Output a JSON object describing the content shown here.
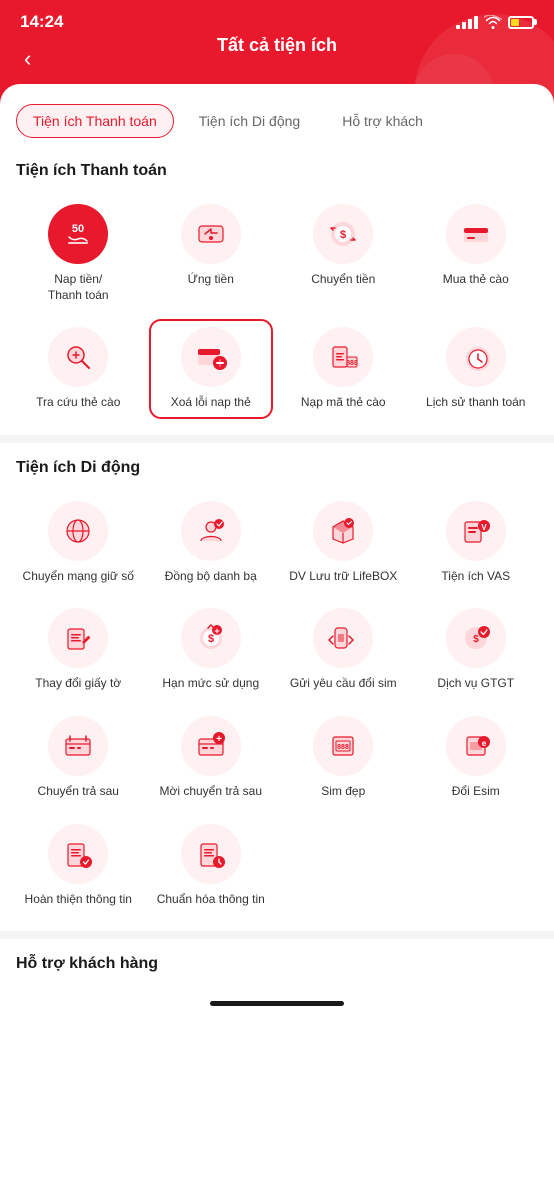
{
  "statusBar": {
    "time": "14:24"
  },
  "header": {
    "title": "Tất cả tiện ích",
    "backLabel": "<"
  },
  "tabs": [
    {
      "id": "payment",
      "label": "Tiện ích Thanh toán",
      "active": true
    },
    {
      "id": "mobile",
      "label": "Tiện ích Di động",
      "active": false
    },
    {
      "id": "support",
      "label": "Hỗ trợ khách",
      "active": false
    }
  ],
  "sections": {
    "payment": {
      "title": "Tiện ích Thanh toán",
      "items": [
        {
          "id": "nap-tien",
          "label": "Nap tiền/\nThanh toán",
          "highlighted": false
        },
        {
          "id": "ung-tien",
          "label": "Ứng tiền",
          "highlighted": false
        },
        {
          "id": "chuyen-tien",
          "label": "Chuyển tiền",
          "highlighted": false
        },
        {
          "id": "mua-the-cao",
          "label": "Mua thẻ cào",
          "highlighted": false
        },
        {
          "id": "tra-cuu-the-cao",
          "label": "Tra cứu thẻ cào",
          "highlighted": false
        },
        {
          "id": "xoa-loi-nap-the",
          "label": "Xoá lỗi nap thẻ",
          "highlighted": true
        },
        {
          "id": "nap-ma-the-cao",
          "label": "Nạp mã thẻ cào",
          "highlighted": false
        },
        {
          "id": "lich-su-thanh-toan",
          "label": "Lịch sử thanh toán",
          "highlighted": false
        }
      ]
    },
    "mobile": {
      "title": "Tiện ích Di động",
      "items": [
        {
          "id": "chuyen-mang-giu-so",
          "label": "Chuyển mạng giữ số",
          "highlighted": false
        },
        {
          "id": "dong-bo-danh-ba",
          "label": "Đồng bộ danh bạ",
          "highlighted": false
        },
        {
          "id": "dv-luu-tru-lifebox",
          "label": "DV Lưu trữ LifeBOX",
          "highlighted": false
        },
        {
          "id": "tien-ich-vas",
          "label": "Tiện ích VAS",
          "highlighted": false
        },
        {
          "id": "thay-doi-giay-to",
          "label": "Thay đổi giấy tờ",
          "highlighted": false
        },
        {
          "id": "han-muc-su-dung",
          "label": "Hạn mức sử dụng",
          "highlighted": false
        },
        {
          "id": "gui-yeu-cau-doi-sim",
          "label": "Gửi yêu cầu đổi sim",
          "highlighted": false
        },
        {
          "id": "dich-vu-gtgt",
          "label": "Dịch vụ GTGT",
          "highlighted": false
        },
        {
          "id": "chuyen-tra-sau",
          "label": "Chuyển trả sau",
          "highlighted": false
        },
        {
          "id": "moi-chuyen-tra-sau",
          "label": "Mời chuyển trả sau",
          "highlighted": false
        },
        {
          "id": "sim-dep",
          "label": "Sim đẹp",
          "highlighted": false
        },
        {
          "id": "doi-esim",
          "label": "Đổi Esim",
          "highlighted": false
        },
        {
          "id": "hoan-thien-thong-tin",
          "label": "Hoàn thiện thông tin",
          "highlighted": false
        },
        {
          "id": "chuan-hoa-thong-tin",
          "label": "Chuẩn hóa thông tin",
          "highlighted": false
        }
      ]
    },
    "support": {
      "title": "Hỗ trợ khách hàng"
    }
  }
}
